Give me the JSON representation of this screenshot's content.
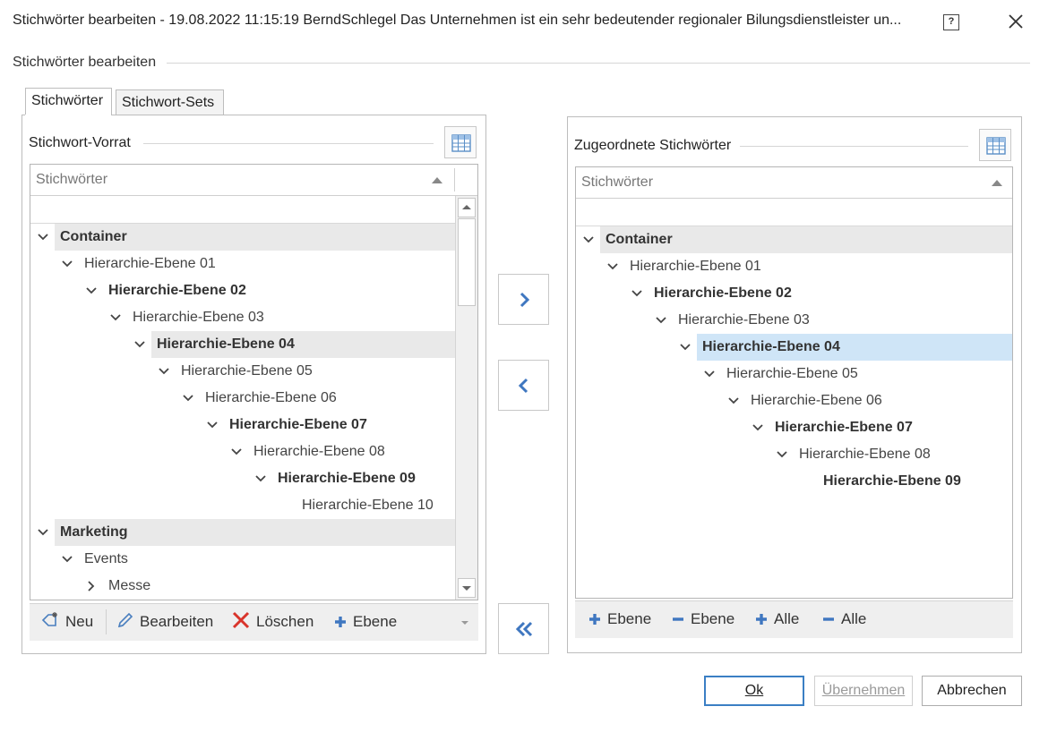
{
  "window": {
    "title": "Stichwörter bearbeiten - 19.08.2022 11:15:19 BerndSchlegel Das Unternehmen ist ein sehr bedeutender regionaler Bilungsdienstleister un...",
    "help_label": "?"
  },
  "group": {
    "label": "Stichwörter bearbeiten"
  },
  "tabs": [
    {
      "label": "Stichwörter",
      "active": true
    },
    {
      "label": "Stichwort-Sets",
      "active": false
    }
  ],
  "left": {
    "section_label": "Stichwort-Vorrat",
    "column_header": "Stichwörter",
    "sort": "ascending",
    "rows": [
      {
        "label": "Container",
        "bold": true,
        "expanded": true,
        "level": 0,
        "group": true
      },
      {
        "label": "Hierarchie-Ebene 01",
        "bold": false,
        "expanded": true,
        "level": 1
      },
      {
        "label": "Hierarchie-Ebene 02",
        "bold": true,
        "expanded": true,
        "level": 2
      },
      {
        "label": "Hierarchie-Ebene 03",
        "bold": false,
        "expanded": true,
        "level": 3
      },
      {
        "label": "Hierarchie-Ebene 04",
        "bold": true,
        "expanded": true,
        "level": 4,
        "highlight": true
      },
      {
        "label": "Hierarchie-Ebene 05",
        "bold": false,
        "expanded": true,
        "level": 5
      },
      {
        "label": "Hierarchie-Ebene 06",
        "bold": false,
        "expanded": true,
        "level": 6
      },
      {
        "label": "Hierarchie-Ebene 07",
        "bold": true,
        "expanded": true,
        "level": 7
      },
      {
        "label": "Hierarchie-Ebene 08",
        "bold": false,
        "expanded": true,
        "level": 8
      },
      {
        "label": "Hierarchie-Ebene 09",
        "bold": true,
        "expanded": true,
        "level": 9
      },
      {
        "label": "Hierarchie-Ebene 10",
        "bold": false,
        "expanded": null,
        "level": 10
      },
      {
        "label": "Marketing",
        "bold": true,
        "expanded": true,
        "level": 0,
        "group": true
      },
      {
        "label": "Events",
        "bold": false,
        "expanded": true,
        "level": 1
      },
      {
        "label": "Messe",
        "bold": false,
        "expanded": false,
        "level": 2
      }
    ],
    "toolbar": {
      "new_label": "Neu",
      "edit_label": "Bearbeiten",
      "delete_label": "Löschen",
      "level_label": "Ebene"
    }
  },
  "transfer": {
    "add_icon": "chevron-right-icon",
    "remove_icon": "chevron-left-icon",
    "remove_all_icon": "double-chevron-left-icon"
  },
  "right": {
    "section_label": "Zugeordnete Stichwörter",
    "column_header": "Stichwörter",
    "sort": "ascending",
    "rows": [
      {
        "label": "Container",
        "bold": true,
        "expanded": true,
        "level": 0,
        "group": true
      },
      {
        "label": "Hierarchie-Ebene 01",
        "bold": false,
        "expanded": true,
        "level": 1
      },
      {
        "label": "Hierarchie-Ebene 02",
        "bold": true,
        "expanded": true,
        "level": 2
      },
      {
        "label": "Hierarchie-Ebene 03",
        "bold": false,
        "expanded": true,
        "level": 3
      },
      {
        "label": "Hierarchie-Ebene 04",
        "bold": true,
        "expanded": true,
        "level": 4,
        "selected": true
      },
      {
        "label": "Hierarchie-Ebene 05",
        "bold": false,
        "expanded": true,
        "level": 5
      },
      {
        "label": "Hierarchie-Ebene 06",
        "bold": false,
        "expanded": true,
        "level": 6
      },
      {
        "label": "Hierarchie-Ebene 07",
        "bold": true,
        "expanded": true,
        "level": 7
      },
      {
        "label": "Hierarchie-Ebene 08",
        "bold": false,
        "expanded": true,
        "level": 8
      },
      {
        "label": "Hierarchie-Ebene 09",
        "bold": true,
        "expanded": null,
        "level": 9
      }
    ],
    "toolbar": {
      "expand_level_label": "Ebene",
      "collapse_level_label": "Ebene",
      "expand_all_label": "Alle",
      "collapse_all_label": "Alle"
    }
  },
  "footer": {
    "ok_label": "Ok",
    "apply_label": "Übernehmen",
    "cancel_label": "Abbrechen"
  },
  "colors": {
    "accent": "#3b7fc4",
    "selection": "#cfe5f7",
    "group_row": "#e9e9e9",
    "delete_red": "#d9342b"
  }
}
